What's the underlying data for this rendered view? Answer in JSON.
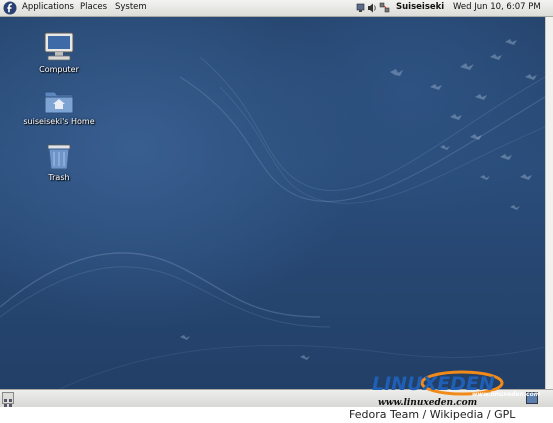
{
  "top_panel": {
    "menus": [
      "Applications",
      "Places",
      "System"
    ],
    "user_name": "Suiseiseki",
    "clock": "Wed Jun 10,  6:07 PM"
  },
  "desktop": {
    "icons": [
      {
        "label": "Computer",
        "icon": "computer-icon"
      },
      {
        "label": "suiseiseki's Home",
        "icon": "home-folder-icon"
      },
      {
        "label": "Trash",
        "icon": "trash-icon"
      }
    ]
  },
  "watermark": {
    "logo_text": "LINUXEDEN",
    "logo_sub": "www.linuxeden.com",
    "url": "www.linuxeden.com"
  },
  "credit": "Fedora Team / Wikipedia / GPL",
  "colors": {
    "desktop_bg": "#26466f",
    "panel_bg": "#e6e6e3",
    "watermark_blue": "#1f5fb5",
    "watermark_orange": "#f28a1a"
  }
}
